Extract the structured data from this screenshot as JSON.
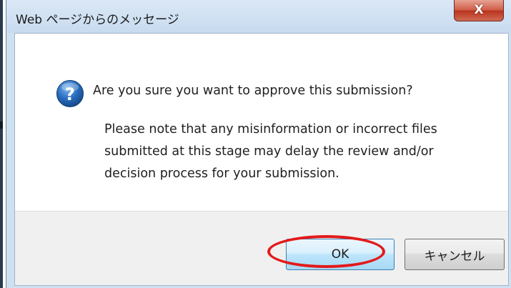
{
  "dialog": {
    "title": "Web ページからのメッセージ",
    "close_label": "X",
    "icon": "question-icon",
    "message": "Are you sure you want to approve this submission?",
    "note_lines": [
      "Please note that any misinformation or incorrect files",
      "submitted at this stage may delay the review and/or",
      "decision process for your submission."
    ],
    "buttons": {
      "ok_label": "OK",
      "cancel_label": "キャンセル"
    }
  },
  "annotation": {
    "highlight_color": "#e31a1a",
    "highlight_target": "ok-button"
  },
  "colors": {
    "titlebar": "#c7dbef",
    "close_button": "#c7452f",
    "ok_border": "#3c7fb1",
    "icon_blue": "#2a6fc0"
  }
}
